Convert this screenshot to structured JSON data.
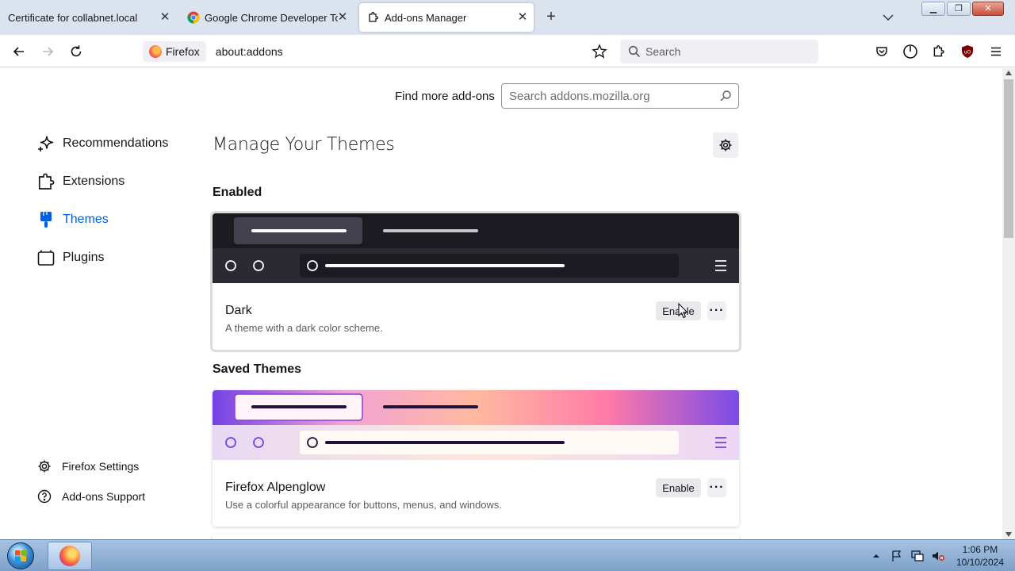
{
  "browser": {
    "tabs": [
      {
        "label": "Certificate for collabnet.local",
        "icon": "none"
      },
      {
        "label": "Google Chrome Developer Tool",
        "icon": "chrome-icon"
      },
      {
        "label": "Add-ons Manager",
        "icon": "puzzle-icon",
        "active": true
      }
    ],
    "identity_label": "Firefox",
    "url": "about:addons",
    "search_placeholder": "Search"
  },
  "page": {
    "find_more_label": "Find more add-ons",
    "amo_search_placeholder": "Search addons.mozilla.org",
    "heading": "Manage Your Themes",
    "categories": [
      {
        "label": "Recommendations",
        "icon": "sparkle-icon"
      },
      {
        "label": "Extensions",
        "icon": "puzzle-icon"
      },
      {
        "label": "Themes",
        "icon": "brush-icon",
        "selected": true
      },
      {
        "label": "Plugins",
        "icon": "plugin-icon"
      }
    ],
    "footer_links": [
      {
        "label": "Firefox Settings",
        "icon": "gear-icon"
      },
      {
        "label": "Add-ons Support",
        "icon": "help-icon"
      }
    ],
    "sections": {
      "enabled_title": "Enabled",
      "saved_title": "Saved Themes"
    },
    "themes": [
      {
        "name": "Dark",
        "description": "A theme with a dark color scheme.",
        "button": "Enable"
      },
      {
        "name": "Firefox Alpenglow",
        "description": "Use a colorful appearance for buttons, menus, and windows.",
        "button": "Enable"
      }
    ]
  },
  "taskbar": {
    "time": "1:06 PM",
    "date": "10/10/2024"
  },
  "colors": {
    "accent": "#0061e0",
    "dark_theme_bg": "#1c1b22",
    "tabstrip": "#dbe3ef"
  }
}
